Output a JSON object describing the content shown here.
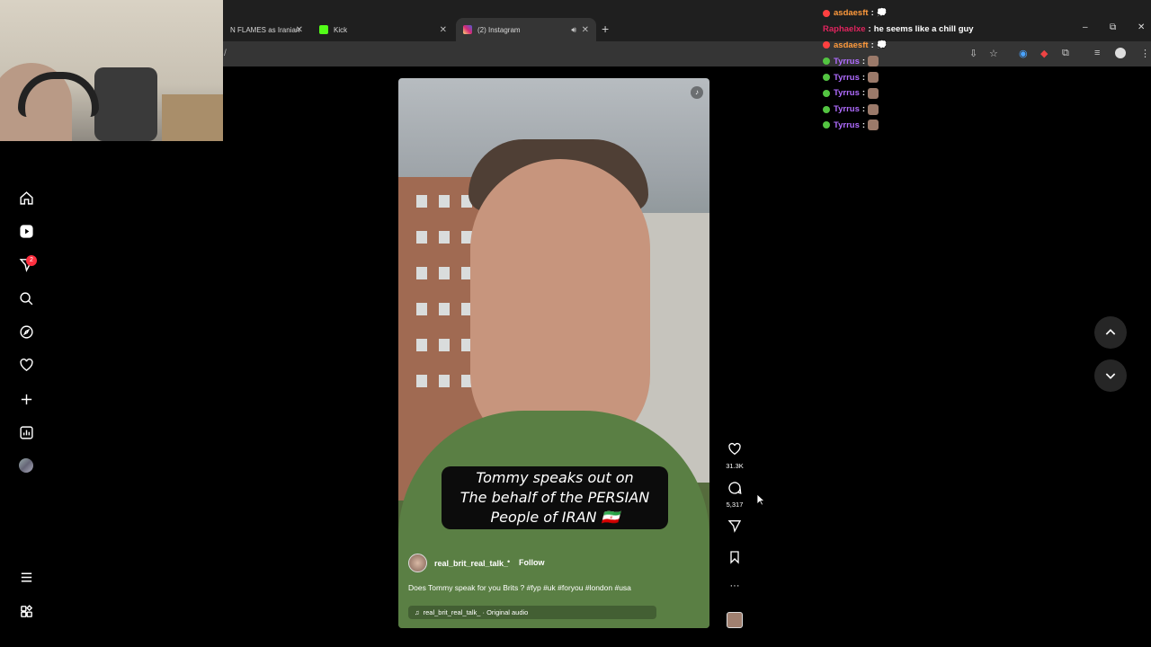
{
  "browser": {
    "tabs": [
      {
        "title": "N FLAMES as Iranian",
        "icon": "page-icon"
      },
      {
        "title": "Kick",
        "icon": "kick-icon"
      },
      {
        "title": "(2) Instagram",
        "icon": "instagram-icon"
      }
    ],
    "new_tab": "+",
    "address_fragment": "/",
    "window_controls": {
      "minimize": "–",
      "maximize": "⧉",
      "close": "✕"
    }
  },
  "chat": {
    "messages": [
      {
        "user": "asdaesft",
        "color": "#ff9a3c",
        "badge_color": "#ff4040",
        "sep": ":",
        "text": ""
      },
      {
        "user": "Raphaelxe",
        "color": "#e0245e",
        "badge_color": "",
        "sep": ":",
        "text": "he seems like a chill guy"
      },
      {
        "user": "asdaesft",
        "color": "#ff9a3c",
        "badge_color": "#ff4040",
        "sep": ":",
        "text": ""
      },
      {
        "user": "Tyrrus",
        "color": "#b06cff",
        "badge_color": "#53c441",
        "sep": ":",
        "text": ""
      },
      {
        "user": "Tyrrus",
        "color": "#b06cff",
        "badge_color": "#53c441",
        "sep": ":",
        "text": ""
      },
      {
        "user": "Tyrrus",
        "color": "#b06cff",
        "badge_color": "#53c441",
        "sep": ":",
        "text": ""
      },
      {
        "user": "Tyrrus",
        "color": "#b06cff",
        "badge_color": "#53c441",
        "sep": ":",
        "text": ""
      },
      {
        "user": "Tyrrus",
        "color": "#b06cff",
        "badge_color": "#53c441",
        "sep": ":",
        "text": ""
      }
    ]
  },
  "sidebar": {
    "notification_count": "2",
    "items": [
      "home-icon",
      "reels-icon",
      "messages-icon",
      "search-icon",
      "explore-icon",
      "notifications-icon",
      "create-icon",
      "dashboard-icon",
      "profile-avatar",
      "menu-icon",
      "threads-icon"
    ]
  },
  "reel": {
    "caption_lines": [
      "Tommy speaks out on",
      "The behalf of the PERSIAN",
      "People of IRAN 🇮🇷"
    ],
    "author": "real_brit_real_talk_",
    "dot": "•",
    "follow_label": "Follow",
    "description": "Does Tommy speak for you Brits ? #fyp #uk #foryou #london #usa",
    "audio": "real_brit_real_talk_ · Original audio",
    "likes": "31.3K",
    "comments": "5,317",
    "more": "···"
  },
  "colors": {
    "accent_badge": "#ff3040",
    "chat_green": "#53c441",
    "hoodie": "#5a7f44"
  }
}
